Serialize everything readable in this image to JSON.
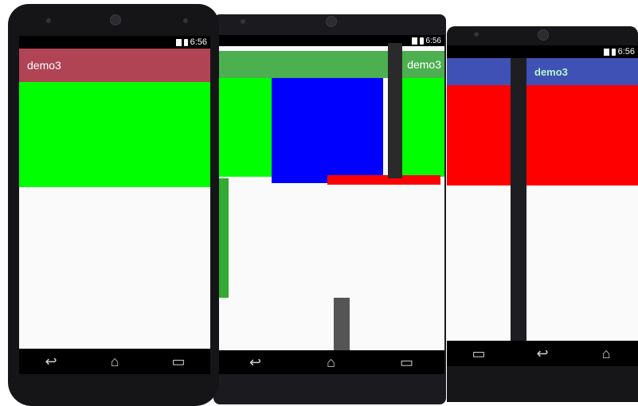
{
  "devices": [
    {
      "status": {
        "time": "6:56"
      },
      "app": {
        "title": "demo3",
        "bar_color": "#b04455"
      },
      "blocks": [
        {
          "color": "#00ff00"
        }
      ],
      "nav": {
        "back": "↩",
        "home": "⌂",
        "recents": "▭"
      }
    },
    {
      "status": {
        "time": "6:56"
      },
      "app": {
        "title": "demo3",
        "bar_color": "#4caf50"
      },
      "blocks": [
        {
          "color": "#00ff00"
        },
        {
          "color": "#0000ff"
        },
        {
          "color": "#ff0000"
        }
      ],
      "nav": {
        "back": "↩",
        "home": "⌂",
        "recents": "▭"
      }
    },
    {
      "status": {
        "time": "6:56"
      },
      "app": {
        "title": "demo3",
        "bar_color": "#3f51b5"
      },
      "blocks": [
        {
          "color": "#ff0000"
        }
      ],
      "nav": {
        "back": "↩",
        "home": "⌂",
        "recents": "▭"
      }
    }
  ]
}
